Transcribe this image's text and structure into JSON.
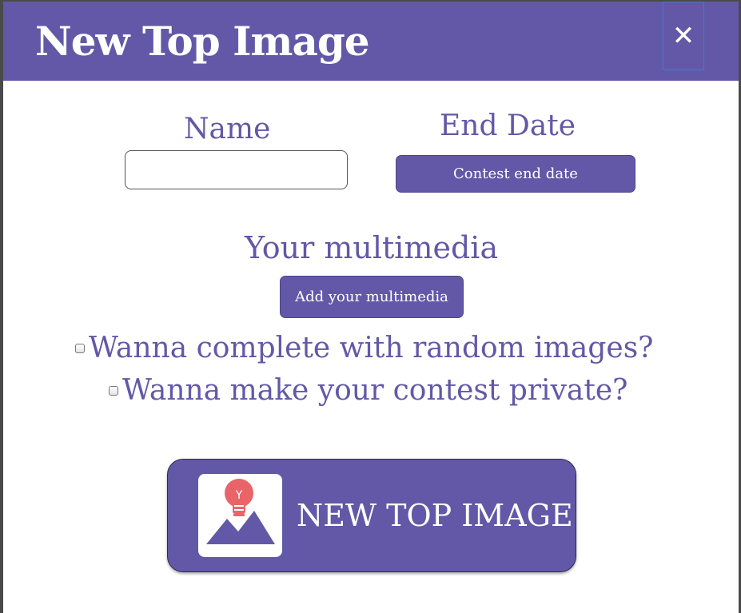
{
  "dialog": {
    "title": "New Top Image",
    "close_icon": "close-icon"
  },
  "form": {
    "name_label": "Name",
    "name_value": "",
    "name_placeholder": "",
    "end_date_label": "End Date",
    "end_date_button": "Contest end date",
    "multimedia_label": "Your multimedia",
    "multimedia_button": "Add your multimedia",
    "random_images_label": "Wanna complete with random images?",
    "random_images_checked": false,
    "private_label": "Wanna make your contest private?",
    "private_checked": false
  },
  "submit": {
    "label": "NEW TOP IMAGE",
    "icon": "image-idea-icon",
    "icon_bulb_text": "Y"
  },
  "colors": {
    "primary": "#6358a7",
    "white": "#ffffff",
    "bulb": "#e86468",
    "focus_border": "#3c7bd6"
  }
}
